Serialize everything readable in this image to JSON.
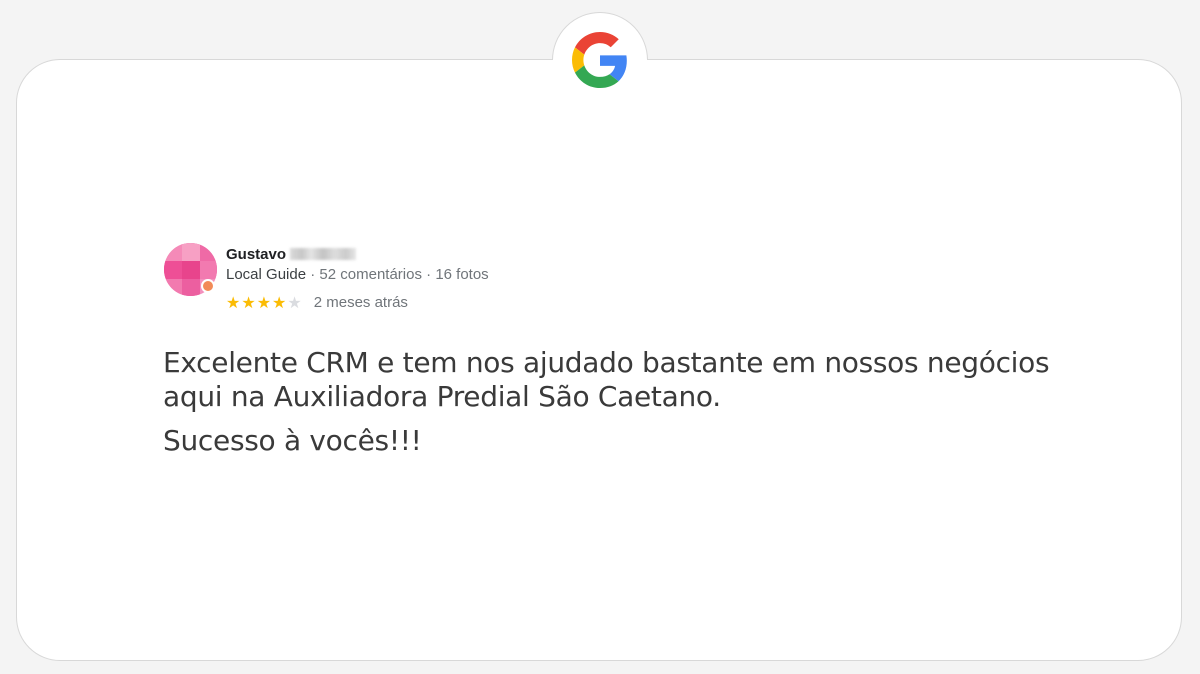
{
  "brand": {
    "logo_icon": "google-g-icon",
    "colors": {
      "blue": "#4285F4",
      "red": "#EA4335",
      "yellow": "#FBBC05",
      "green": "#34A853"
    }
  },
  "review": {
    "author_name": "Gustavo",
    "author_surname_redacted": true,
    "badge": "Local Guide",
    "separator": "·",
    "comments": "52 comentários",
    "photos": "16 fotos",
    "rating": 4,
    "rating_max": 5,
    "time_ago": "2 meses atrás",
    "text_paragraph_1": "Excelente CRM e tem nos ajudado bastante em nossos negócios aqui na Auxiliadora Predial São Caetano.",
    "text_paragraph_2": "Sucesso à vocês!!!",
    "star_color": "#fbbc04"
  }
}
